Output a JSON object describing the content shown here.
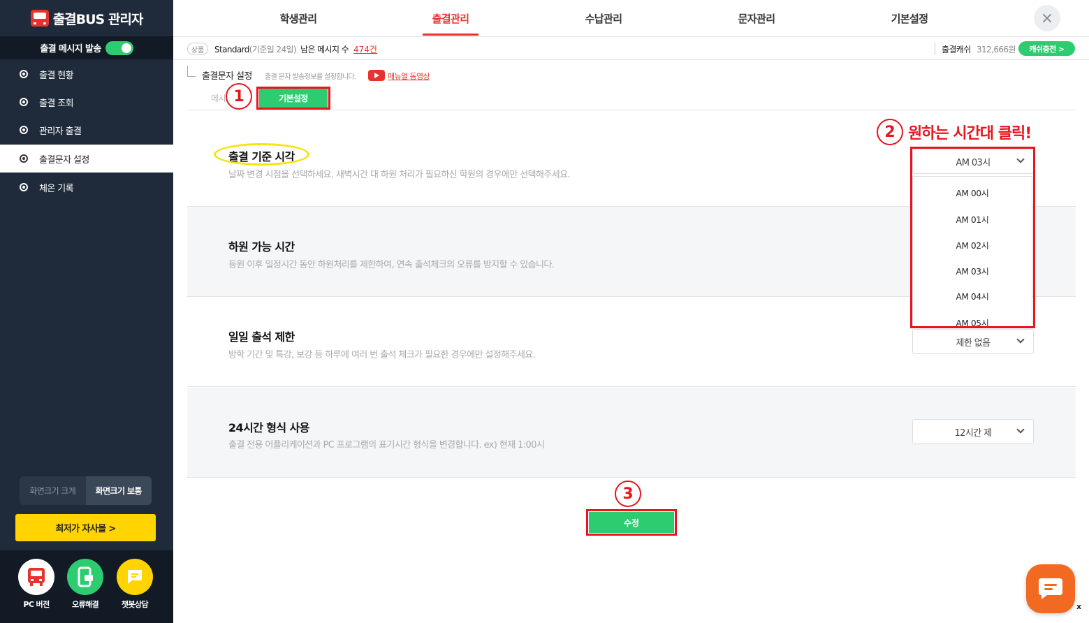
{
  "app": {
    "title": "출결BUS 관리자",
    "msg_toggle_label": "출결 메시지 발송",
    "msg_toggle_on": true
  },
  "sidebar": {
    "items": [
      {
        "label": "출결 현황"
      },
      {
        "label": "출결 조회"
      },
      {
        "label": "관리자 출결"
      },
      {
        "label": "출결문자 설정",
        "active": true
      },
      {
        "label": "체온 기록"
      }
    ],
    "size_large": "화면크기 크게",
    "size_normal": "화면크기 보통",
    "shop_button": "최저가 자사몰  >",
    "bottom": [
      {
        "label": "PC 버전",
        "icon": "bus-icon",
        "color": "#e8322f"
      },
      {
        "label": "오류해결",
        "icon": "phone-icon",
        "color": "#2ecc71"
      },
      {
        "label": "챗봇상담",
        "icon": "chat-icon",
        "color": "#ffd400"
      }
    ]
  },
  "top_nav": {
    "tabs": [
      {
        "label": "학생관리"
      },
      {
        "label": "출결관리",
        "active": true
      },
      {
        "label": "수납관리"
      },
      {
        "label": "문자관리"
      },
      {
        "label": "기본설정"
      }
    ],
    "close_icon": "×"
  },
  "info_bar": {
    "product_badge": "상품",
    "plan": "Standard",
    "plan_sub": "(기준일 24일)",
    "remain_label": "남은 메시지 수",
    "remain_count": "474건",
    "cash_label": "출결캐쉬",
    "cash_amount": "312,666원",
    "charge_button": "캐쉬충전  >"
  },
  "section": {
    "title": "출결문자 설정",
    "desc": "출결 문자 발송정보를 설정합니다.",
    "manual_link": "매뉴얼 동영상",
    "subtab_msg": "메시지",
    "subtab_basic": "기본설정"
  },
  "settings": [
    {
      "title": "출결 기준 시각",
      "desc": "날짜 변경 시점을 선택하세요. 새벽시간 대 하원 처리가 필요하신 학원의 경우에만 선택해주세요.",
      "value": "AM 03시"
    },
    {
      "title": "하원 가능 시간",
      "desc": "등원 이후 일정시간 동안 하원처리를 제한하여, 연속 출석체크의 오류를 방지할 수 있습니다.",
      "value": ""
    },
    {
      "title": "일일 출석 제한",
      "desc": "방학 기간 및 특강, 보강 등 하루에 여러 번 출석 체크가 필요한 경우에만 설정해주세요.",
      "value": "제한 없음"
    },
    {
      "title": "24시간 형식 사용",
      "desc": "출결 전용 어플리케이션과 PC 프로그램의 표기시간 형식을 변경합니다. ex) 현재 1:00시",
      "value": "12시간 제"
    }
  ],
  "dropdown_options": [
    "AM 00시",
    "AM 01시",
    "AM 02시",
    "AM 03시",
    "AM 04시",
    "AM 05시"
  ],
  "annotations": {
    "step1": "1",
    "step2": "2",
    "step3": "3",
    "step2_text": "원하는 시간대 클릭!",
    "box_color": "#e8141e",
    "ellipse_color": "#f5e50a"
  },
  "submit_label": "수정",
  "chat_close": "x",
  "colors": {
    "accent_red": "#e8322f",
    "accent_green": "#2ecc71",
    "sidebar_bg": "#1f2b3a",
    "fab_orange": "#f26a21"
  }
}
